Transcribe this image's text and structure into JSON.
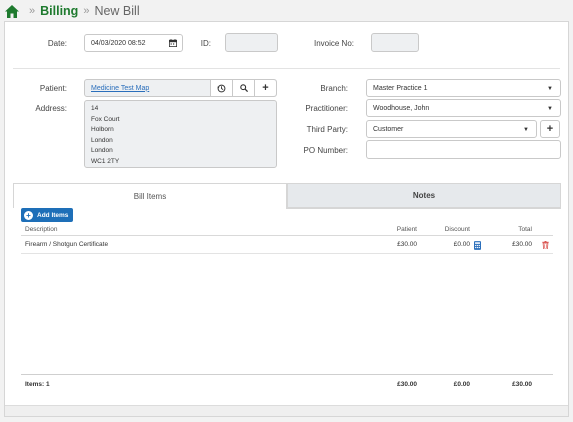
{
  "breadcrumb": {
    "section": "Billing",
    "page": "New Bill",
    "separator": "»"
  },
  "form": {
    "date_label": "Date:",
    "date_value": "04/03/2020 08:52",
    "id_label": "ID:",
    "invoice_label": "Invoice No:",
    "patient_label": "Patient:",
    "patient_name": "Medicine Test Map",
    "address_label": "Address:",
    "address_lines": [
      "14",
      "Fox Court",
      "Holborn",
      "London",
      "London",
      "WC1 2TY"
    ],
    "branch_label": "Branch:",
    "branch_value": "Master Practice 1",
    "practitioner_label": "Practitioner:",
    "practitioner_value": "Woodhouse, John",
    "third_party_label": "Third Party:",
    "third_party_value": "Customer",
    "po_label": "PO Number:"
  },
  "tabs": [
    {
      "label": "Bill Items",
      "active": true
    },
    {
      "label": "Notes",
      "active": false
    }
  ],
  "items": {
    "add_label": "Add Items",
    "columns": {
      "description": "Description",
      "patient": "Patient",
      "discount": "Discount",
      "total": "Total"
    },
    "rows": [
      {
        "description": "Firearm / Shotgun Certificate",
        "patient": "£30.00",
        "discount": "£0.00",
        "total": "£30.00"
      }
    ],
    "footer": {
      "count": "Items: 1",
      "patient": "£30.00",
      "discount": "£0.00",
      "total": "£30.00"
    }
  },
  "colors": {
    "brand_green": "#1e7a2e",
    "primary_blue": "#1e6fb8",
    "delete_red": "#d9534f",
    "link_blue": "#2a6ebb"
  },
  "icons": {
    "home": "home-icon",
    "calendar": "calendar-icon",
    "refresh": "refresh-icon",
    "search": "search-icon",
    "plus": "plus-icon",
    "calculator": "calculator-icon",
    "trash": "trash-icon"
  }
}
